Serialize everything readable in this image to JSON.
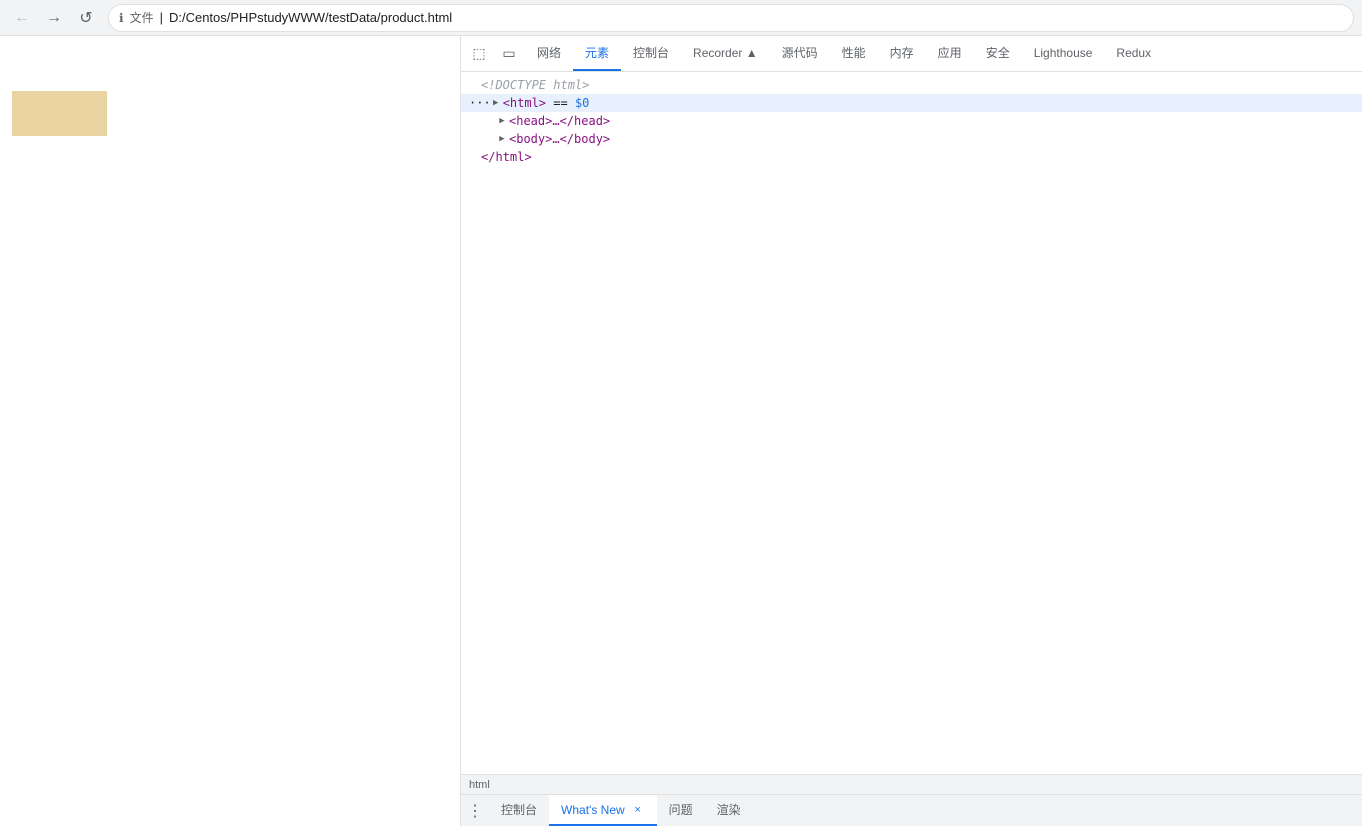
{
  "browser": {
    "back_label": "←",
    "forward_label": "→",
    "reload_label": "↺",
    "address_lock": "ℹ",
    "address_file_label": "文件",
    "address_separator": "|",
    "address_url": "D:/Centos/PHPstudyWWW/testData/product.html"
  },
  "devtools": {
    "icon_inspect": "⬚",
    "icon_device": "▭",
    "tabs": [
      {
        "id": "network",
        "label": "网络",
        "active": false
      },
      {
        "id": "elements",
        "label": "元素",
        "active": true
      },
      {
        "id": "console",
        "label": "控制台",
        "active": false
      },
      {
        "id": "recorder",
        "label": "Recorder ▲",
        "active": false
      },
      {
        "id": "sources",
        "label": "源代码",
        "active": false
      },
      {
        "id": "performance",
        "label": "性能",
        "active": false
      },
      {
        "id": "memory",
        "label": "内存",
        "active": false
      },
      {
        "id": "application",
        "label": "应用",
        "active": false
      },
      {
        "id": "security",
        "label": "安全",
        "active": false
      },
      {
        "id": "lighthouse",
        "label": "Lighthouse",
        "active": false
      },
      {
        "id": "redux",
        "label": "Redux",
        "active": false
      }
    ],
    "dom": {
      "doctype": "<!DOCTYPE html>",
      "html_open": "<html>",
      "html_open_selected": "…<html> == $0",
      "html_indicator": "···",
      "head_line": "<head>…</head>",
      "body_line": "<body>…</body>",
      "html_close": "</html>"
    },
    "statusbar": {
      "path": "html"
    },
    "drawer": {
      "menu_icon": "⋮",
      "tabs": [
        {
          "id": "console",
          "label": "控制台",
          "closable": false,
          "active": false
        },
        {
          "id": "whats-new",
          "label": "What's New",
          "closable": true,
          "active": true
        },
        {
          "id": "issues",
          "label": "问题",
          "closable": false,
          "active": false
        },
        {
          "id": "rendering",
          "label": "渲染",
          "closable": false,
          "active": false
        }
      ]
    }
  }
}
